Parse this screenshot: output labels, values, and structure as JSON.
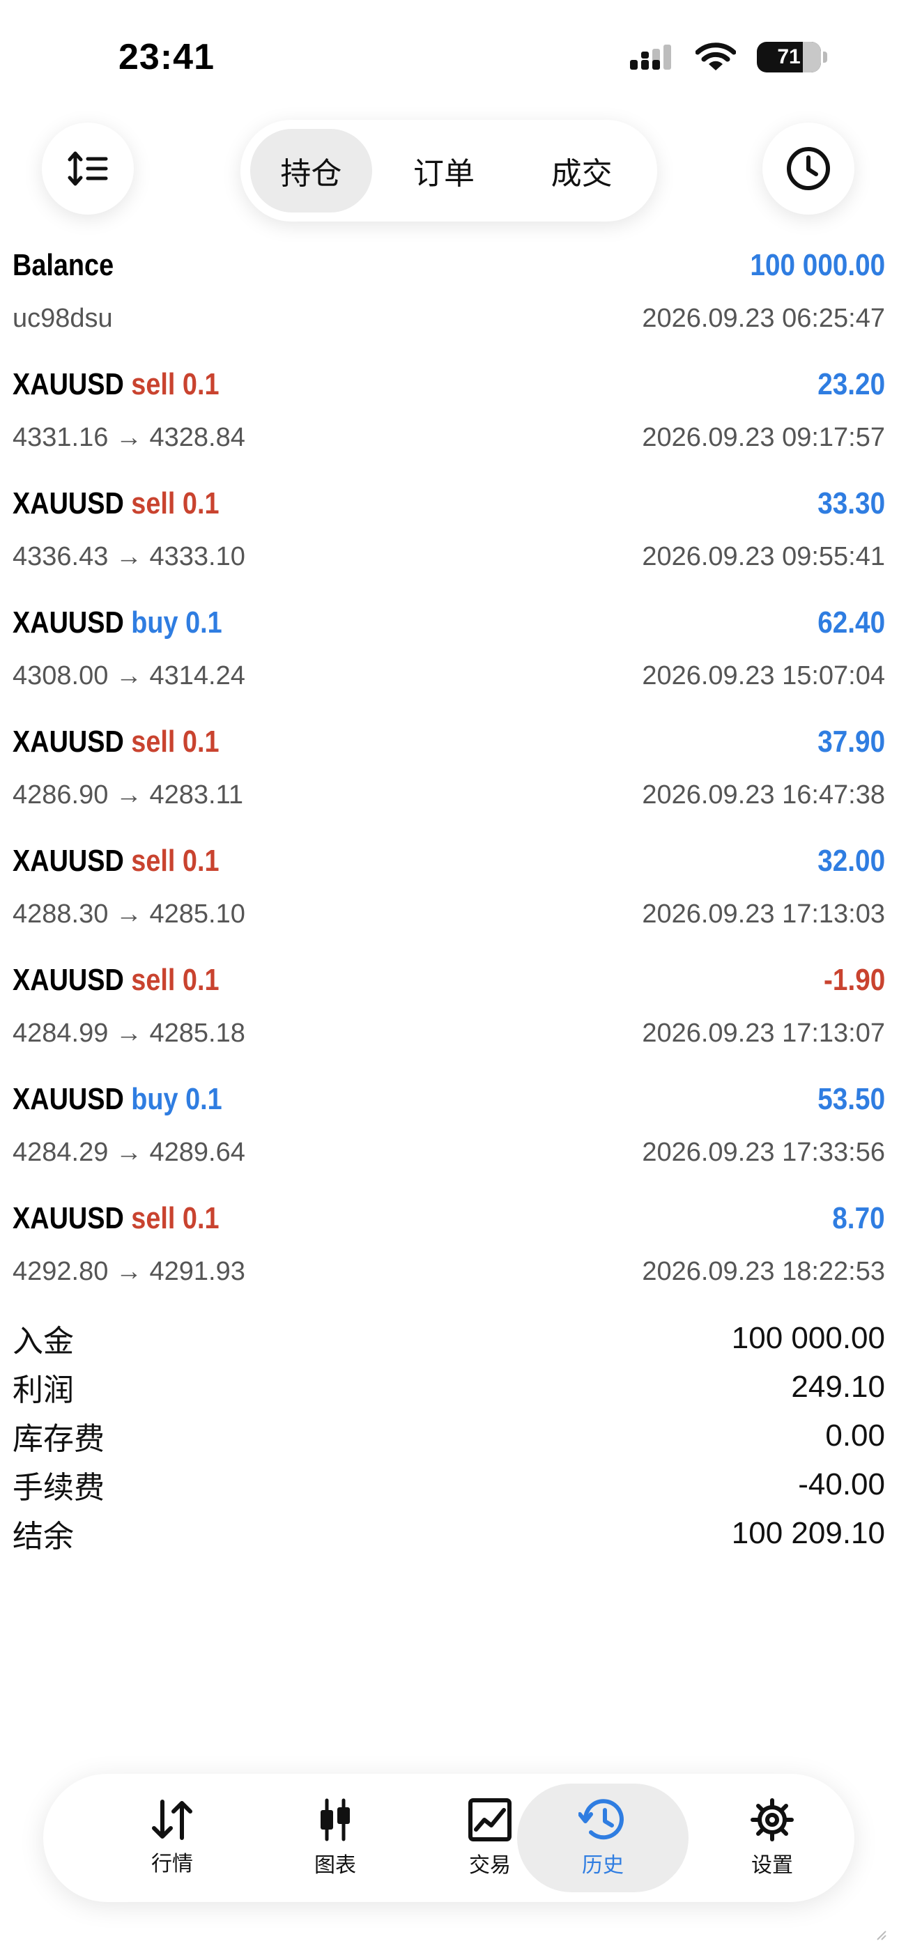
{
  "status_bar": {
    "time": "23:41",
    "battery": "71"
  },
  "header": {
    "tabs": [
      {
        "label": "持仓",
        "active": true
      },
      {
        "label": "订单",
        "active": false
      },
      {
        "label": "成交",
        "active": false
      }
    ]
  },
  "balance": {
    "title": "Balance",
    "value": "100 000.00",
    "account": "uc98dsu",
    "time": "2026.09.23 06:25:47"
  },
  "deals": [
    {
      "symbol": "XAUUSD",
      "side": "sell 0.1",
      "profit": "23.20",
      "prices": "4331.16 → 4328.84",
      "time": "2026.09.23 09:17:57"
    },
    {
      "symbol": "XAUUSD",
      "side": "sell 0.1",
      "profit": "33.30",
      "prices": "4336.43 → 4333.10",
      "time": "2026.09.23 09:55:41"
    },
    {
      "symbol": "XAUUSD",
      "side": "buy 0.1",
      "profit": "62.40",
      "prices": "4308.00 → 4314.24",
      "time": "2026.09.23 15:07:04"
    },
    {
      "symbol": "XAUUSD",
      "side": "sell 0.1",
      "profit": "37.90",
      "prices": "4286.90 → 4283.11",
      "time": "2026.09.23 16:47:38"
    },
    {
      "symbol": "XAUUSD",
      "side": "sell 0.1",
      "profit": "32.00",
      "prices": "4288.30 → 4285.10",
      "time": "2026.09.23 17:13:03"
    },
    {
      "symbol": "XAUUSD",
      "side": "sell 0.1",
      "profit": "-1.90",
      "prices": "4284.99 → 4285.18",
      "time": "2026.09.23 17:13:07"
    },
    {
      "symbol": "XAUUSD",
      "side": "buy 0.1",
      "profit": "53.50",
      "prices": "4284.29 → 4289.64",
      "time": "2026.09.23 17:33:56"
    },
    {
      "symbol": "XAUUSD",
      "side": "sell 0.1",
      "profit": "8.70",
      "prices": "4292.80 → 4291.93",
      "time": "2026.09.23 18:22:53"
    }
  ],
  "summary": [
    {
      "label": "入金",
      "value": "100 000.00"
    },
    {
      "label": "利润",
      "value": "249.10"
    },
    {
      "label": "库存费",
      "value": "0.00"
    },
    {
      "label": "手续费",
      "value": "-40.00"
    },
    {
      "label": "结余",
      "value": "100 209.10"
    }
  ],
  "tabbar": {
    "items": [
      {
        "label": "行情",
        "icon": "arrows-updown-icon"
      },
      {
        "label": "图表",
        "icon": "candlestick-icon"
      },
      {
        "label": "交易",
        "icon": "trend-chart-icon"
      },
      {
        "label": "历史",
        "icon": "history-clock-icon",
        "active": true
      },
      {
        "label": "设置",
        "icon": "gear-icon"
      }
    ]
  },
  "colors": {
    "buy": "#2f7de1",
    "sell": "#c9432f",
    "profit_positive": "#2f7de1",
    "profit_negative": "#c9432f"
  }
}
